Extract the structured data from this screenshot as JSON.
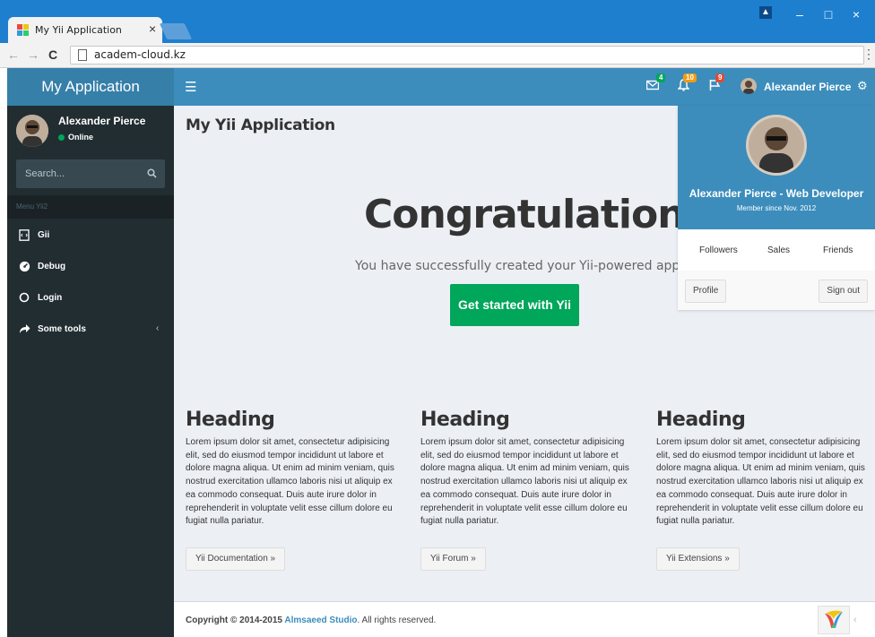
{
  "browser": {
    "tab_title": "My Yii Application",
    "tab_close": "×",
    "url": "academ-cloud.kz",
    "window_controls": {
      "minimize": "–",
      "maximize": "□",
      "close": "×"
    },
    "nav": {
      "back": "←",
      "forward": "→",
      "reload": "C",
      "menu": "⋮"
    }
  },
  "app": {
    "logo": "My Application",
    "nav": {
      "messages_count": "4",
      "notifications_count": "10",
      "tasks_count": "9",
      "user_name": "Alexander Pierce",
      "colors": {
        "messages": "#00a65a",
        "notifications": "#f39c12",
        "tasks": "#dd4b39"
      }
    },
    "sidebar": {
      "user_name": "Alexander Pierce",
      "status": "Online",
      "search_placeholder": "Search...",
      "menu_header": "Menu Yii2",
      "items": [
        {
          "label": "Gii",
          "icon": "file-code-icon"
        },
        {
          "label": "Debug",
          "icon": "dashboard-icon"
        },
        {
          "label": "Login",
          "icon": "circle-icon"
        },
        {
          "label": "Some tools",
          "icon": "share-icon",
          "chevron": "‹"
        }
      ]
    },
    "content": {
      "title": "My Yii Application",
      "jumbotron_heading": "Congratulations!",
      "jumbotron_lead": "You have successfully created your Yii-powered application.",
      "cta": "Get started with Yii",
      "columns": [
        {
          "heading": "Heading",
          "text": "Lorem ipsum dolor sit amet, consectetur adipisicing elit, sed do eiusmod tempor incididunt ut labore et dolore magna aliqua. Ut enim ad minim veniam, quis nostrud exercitation ullamco laboris nisi ut aliquip ex ea commodo consequat. Duis aute irure dolor in reprehenderit in voluptate velit esse cillum dolore eu fugiat nulla pariatur.",
          "button": "Yii Documentation »"
        },
        {
          "heading": "Heading",
          "text": "Lorem ipsum dolor sit amet, consectetur adipisicing elit, sed do eiusmod tempor incididunt ut labore et dolore magna aliqua. Ut enim ad minim veniam, quis nostrud exercitation ullamco laboris nisi ut aliquip ex ea commodo consequat. Duis aute irure dolor in reprehenderit in voluptate velit esse cillum dolore eu fugiat nulla pariatur.",
          "button": "Yii Forum »"
        },
        {
          "heading": "Heading",
          "text": "Lorem ipsum dolor sit amet, consectetur adipisicing elit, sed do eiusmod tempor incididunt ut labore et dolore magna aliqua. Ut enim ad minim veniam, quis nostrud exercitation ullamco laboris nisi ut aliquip ex ea commodo consequat. Duis aute irure dolor in reprehenderit in voluptate velit esse cillum dolore eu fugiat nulla pariatur.",
          "button": "Yii Extensions »"
        }
      ]
    },
    "footer": {
      "prefix": "Copyright © 2014-2015 ",
      "brand": "Almsaeed Studio",
      "suffix": ". All rights reserved."
    },
    "dropdown": {
      "name_title": "Alexander Pierce - Web Developer",
      "member_since": "Member since Nov. 2012",
      "links": [
        "Followers",
        "Sales",
        "Friends"
      ],
      "profile_button": "Profile",
      "signout_button": "Sign out"
    },
    "colors": {
      "primary": "#3c8dbc",
      "success": "#00a65a",
      "sidebar": "#222d32"
    }
  }
}
